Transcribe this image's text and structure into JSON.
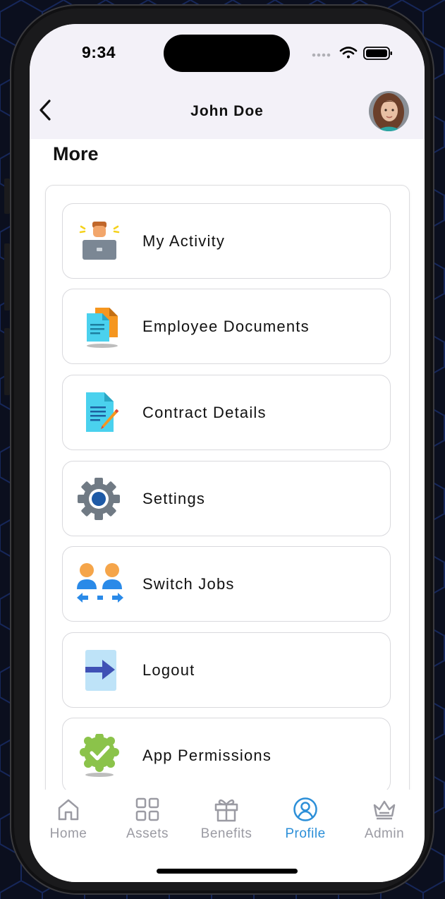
{
  "status_bar": {
    "time": "9:34"
  },
  "header": {
    "title": "John Doe"
  },
  "section": {
    "title": "More"
  },
  "menu": {
    "items": [
      {
        "label": "My Activity",
        "icon": "activity-icon"
      },
      {
        "label": "Employee Documents",
        "icon": "documents-icon"
      },
      {
        "label": "Contract Details",
        "icon": "contract-icon"
      },
      {
        "label": "Settings",
        "icon": "gear-icon"
      },
      {
        "label": "Switch Jobs",
        "icon": "switch-jobs-icon"
      },
      {
        "label": "Logout",
        "icon": "logout-icon"
      },
      {
        "label": "App Permissions",
        "icon": "badge-check-icon"
      }
    ]
  },
  "nav": {
    "items": [
      {
        "label": "Home",
        "icon": "home-icon"
      },
      {
        "label": "Assets",
        "icon": "grid-icon"
      },
      {
        "label": "Benefits",
        "icon": "gift-icon"
      },
      {
        "label": "Profile",
        "icon": "user-circle-icon",
        "active": true
      },
      {
        "label": "Admin",
        "icon": "crown-icon"
      }
    ]
  },
  "colors": {
    "accent": "#2c8fd8",
    "inactive": "#9b9ba3",
    "header_bg": "#f3f1f8"
  }
}
